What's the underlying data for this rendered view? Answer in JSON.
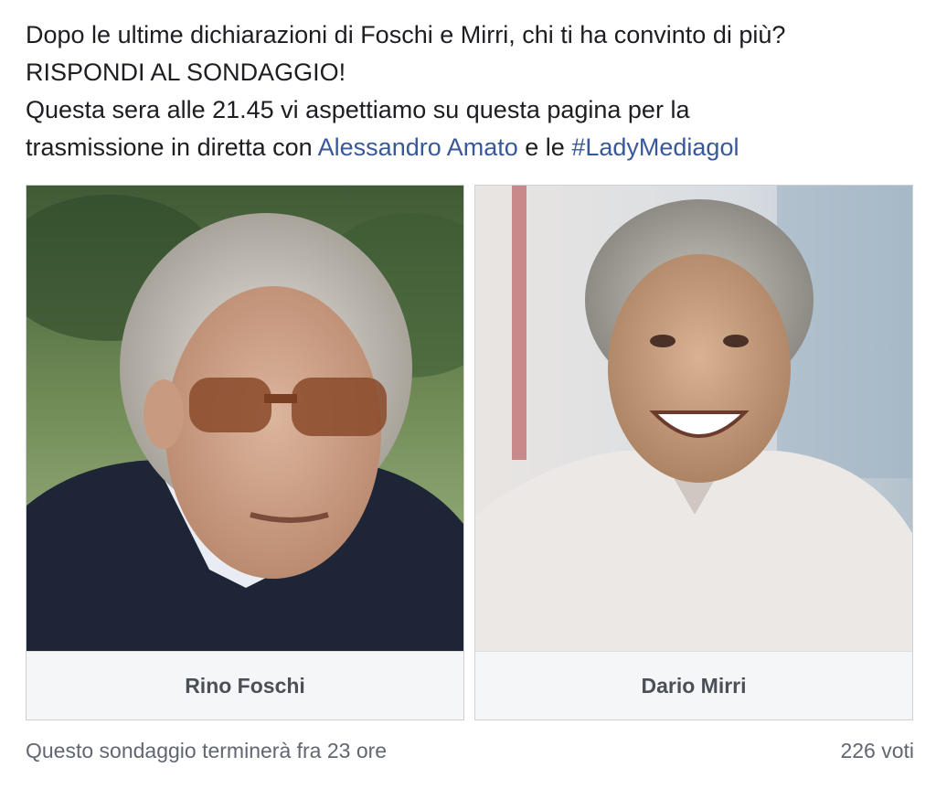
{
  "post": {
    "line1": "Dopo le ultime dichiarazioni di Foschi e Mirri, chi ti ha convinto di più?",
    "line2": "RISPONDI AL SONDAGGIO!",
    "line3": "Questa sera alle 21.45 vi aspettiamo su questa pagina per la",
    "line4_prefix": "trasmissione in diretta con ",
    "mention": "Alessandro Amato",
    "line4_middle": " e le ",
    "hashtag": "#LadyMediagol"
  },
  "poll": {
    "options": [
      {
        "label": "Rino Foschi",
        "photo_icon": "person-photo"
      },
      {
        "label": "Dario Mirri",
        "photo_icon": "person-photo"
      }
    ],
    "time_remaining": "Questo sondaggio terminerà fra 23 ore",
    "votes": "226 voti"
  },
  "colors": {
    "link": "#385898",
    "text": "#1c1e21",
    "option_bg": "#f5f6f7",
    "muted": "#606770"
  }
}
